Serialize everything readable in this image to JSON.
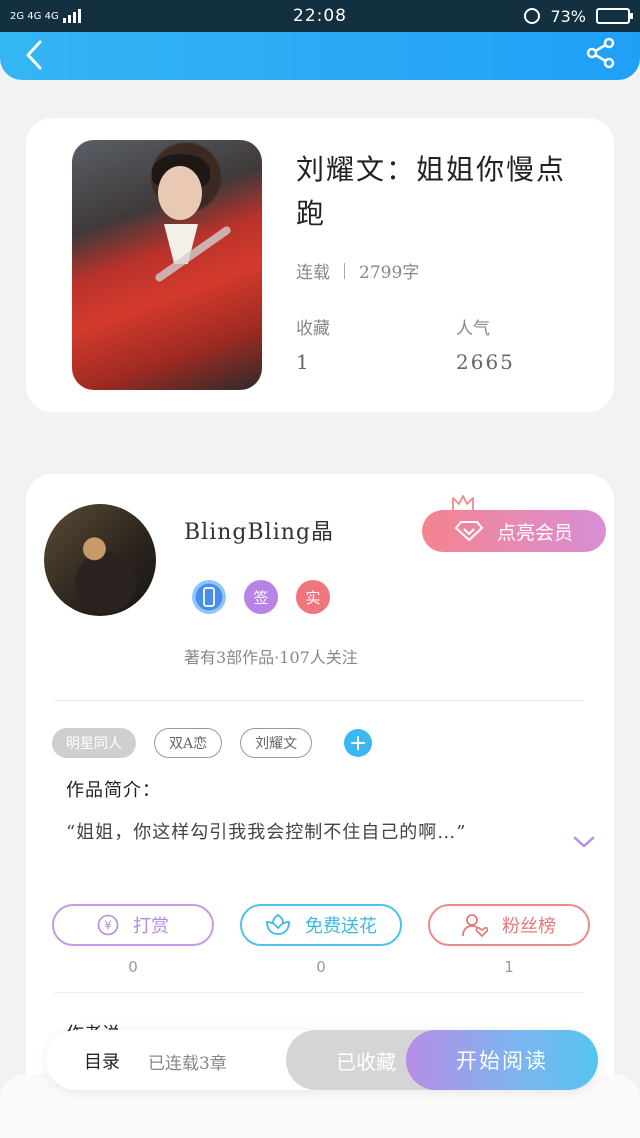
{
  "status_bar": {
    "network": "2G 4G 4G",
    "time": "22:08",
    "battery": "73%",
    "battery_level": 0.73
  },
  "header": {
    "back_icon": "chevron-left-icon",
    "share_icon": "share-icon"
  },
  "book": {
    "title": "刘耀文：姐姐你慢点跑",
    "status": "连载",
    "word_count": "2799字",
    "favorites_label": "收藏",
    "favorites_value": "1",
    "popularity_label": "人气",
    "popularity_value": "2665"
  },
  "author": {
    "name": "BlingBling晶",
    "vip_button": "点亮会员",
    "badges": [
      "签",
      "实"
    ],
    "stats": "著有3部作品·107人关注"
  },
  "tags": [
    "明星同人",
    "双A恋",
    "刘耀文"
  ],
  "intro": {
    "label": "作品简介：",
    "text": "“姐姐，你这样勾引我我会控制不住自己的啊…”"
  },
  "actions": {
    "tip_label": "打赏",
    "tip_count": "0",
    "flower_label": "免费送花",
    "flower_count": "0",
    "fans_label": "粉丝榜",
    "fans_count": "1"
  },
  "author_say": "作者说",
  "bottom_bar": {
    "toc": "目录",
    "toc_status": "已连载3章",
    "collected": "已收藏",
    "read": "开始阅读"
  },
  "colors": {
    "header": "#2aa7f5",
    "vip_gradient_start": "#f5848e",
    "vip_gradient_end": "#d88ed6",
    "read_gradient_start": "#b68ee6",
    "read_gradient_end": "#56c4f1"
  }
}
